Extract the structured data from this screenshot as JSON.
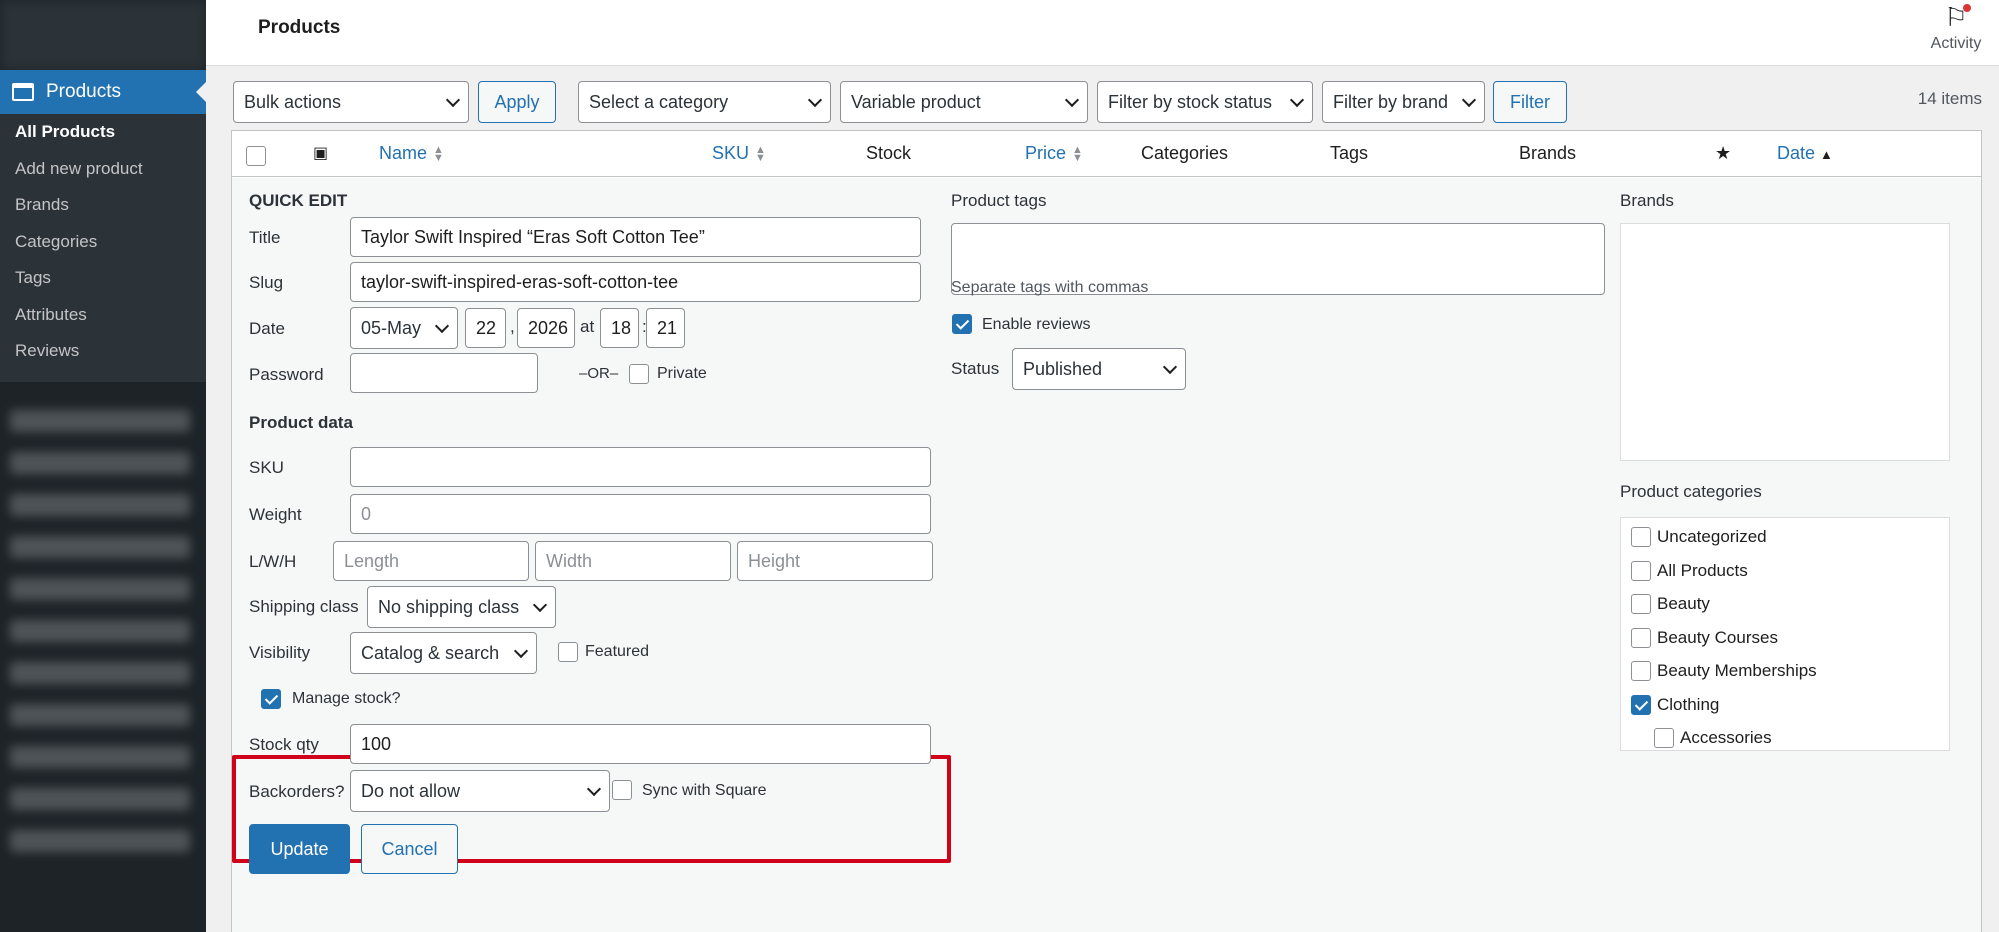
{
  "sidebar": {
    "section": "Products",
    "items": [
      {
        "label": "All Products",
        "current": true
      },
      {
        "label": "Add new product"
      },
      {
        "label": "Brands"
      },
      {
        "label": "Categories"
      },
      {
        "label": "Tags"
      },
      {
        "label": "Attributes"
      },
      {
        "label": "Reviews"
      }
    ]
  },
  "header": {
    "title": "Products",
    "activity": "Activity"
  },
  "filters": {
    "bulk_actions": "Bulk actions",
    "apply": "Apply",
    "category": "Select a category",
    "product_type": "Variable product",
    "stock_status": "Filter by stock status",
    "brand": "Filter by brand",
    "filter": "Filter",
    "count": "14 items"
  },
  "columns": {
    "name": "Name",
    "sku": "SKU",
    "stock": "Stock",
    "price": "Price",
    "categories": "Categories",
    "tags": "Tags",
    "brands": "Brands",
    "date": "Date"
  },
  "quick_edit": {
    "heading": "QUICK EDIT",
    "title_label": "Title",
    "title_value": "Taylor Swift Inspired “Eras Soft Cotton Tee”",
    "slug_label": "Slug",
    "slug_value": "taylor-swift-inspired-eras-soft-cotton-tee",
    "date_label": "Date",
    "month": "05-May",
    "day": "22",
    "year": "2026",
    "at": "at",
    "hour": "18",
    "minute": "21",
    "comma": ",",
    "colon": ":",
    "password_label": "Password",
    "or": "–OR–",
    "private": "Private",
    "product_data": "Product data",
    "sku_label": "SKU",
    "sku_value": "",
    "weight_label": "Weight",
    "weight_placeholder": "0",
    "lwh_label": "L/W/H",
    "length": "Length",
    "width": "Width",
    "height": "Height",
    "shipping_label": "Shipping class",
    "shipping_value": "No shipping class",
    "visibility_label": "Visibility",
    "visibility_value": "Catalog & search",
    "featured": "Featured",
    "manage_stock": "Manage stock?",
    "stock_qty_label": "Stock qty",
    "stock_qty_value": "100",
    "backorders_label": "Backorders?",
    "backorders_value": "Do not allow",
    "sync_square": "Sync with Square",
    "update": "Update",
    "cancel": "Cancel",
    "tags_label": "Product tags",
    "tags_hint": "Separate tags with commas",
    "enable_reviews": "Enable reviews",
    "status_label": "Status",
    "status_value": "Published",
    "brands_label": "Brands",
    "categories_label": "Product categories",
    "categories": [
      {
        "label": "Uncategorized",
        "checked": false,
        "child": false
      },
      {
        "label": "All Products",
        "checked": false,
        "child": false
      },
      {
        "label": "Beauty",
        "checked": false,
        "child": false
      },
      {
        "label": "Beauty Courses",
        "checked": false,
        "child": false
      },
      {
        "label": "Beauty Memberships",
        "checked": false,
        "child": false
      },
      {
        "label": "Clothing",
        "checked": true,
        "child": false
      },
      {
        "label": "Accessories",
        "checked": false,
        "child": true
      }
    ]
  },
  "colors": {
    "accent": "#2271b1",
    "highlight": "#d0021b",
    "sidebar": "#1d2327"
  }
}
